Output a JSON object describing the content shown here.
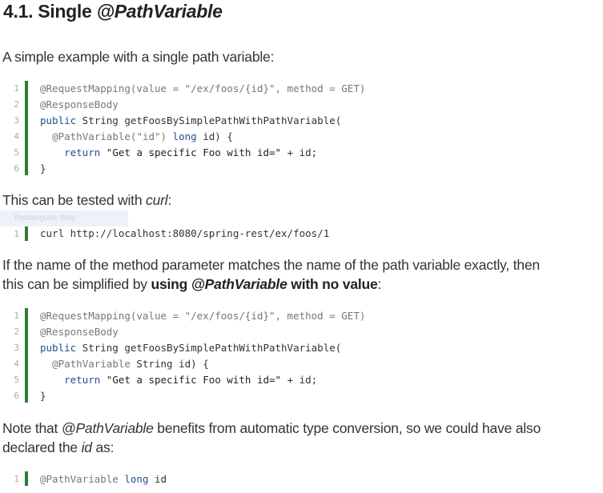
{
  "heading": {
    "prefix": "4.1. Single ",
    "annotation": "@PathVariable"
  },
  "para1": "A simple example with a single path variable:",
  "code1": {
    "lines": [
      "1",
      "2",
      "3",
      "4",
      "5",
      "6"
    ],
    "l1": "@RequestMapping(value = \"/ex/foos/{id}\", method = GET)",
    "l2": "@ResponseBody",
    "l3_kw": "public",
    "l3_rest": " String getFoosBySimplePathWithPathVariable(",
    "l4_ann": "@PathVariable(\"id\")",
    "l4_kw": "long",
    "l4_rest": " id) {",
    "l5_kw": "return",
    "l5_str": "\"Get a specific Foo with id=\"",
    "l5_rest": " + id;",
    "l6": "}"
  },
  "para2": {
    "text": "This can be tested with ",
    "em": "curl",
    "end": ":"
  },
  "tooltip": "Rectangular Snip",
  "code2": {
    "line": "1",
    "text": "curl http://localhost:8080/spring-rest/ex/foos/1"
  },
  "para3": {
    "text1": "If the name of the method parameter matches the name of the path variable exactly, then",
    "text2": "this can be simplified by ",
    "bold1": "using ",
    "bold_em": "@PathVariable",
    "bold2": " with no value",
    "end": ":"
  },
  "code3": {
    "lines": [
      "1",
      "2",
      "3",
      "4",
      "5",
      "6"
    ],
    "l1": "@RequestMapping(value = \"/ex/foos/{id}\", method = GET)",
    "l2": "@ResponseBody",
    "l3_kw": "public",
    "l3_rest": " String getFoosBySimplePathWithPathVariable(",
    "l4_ann": "@PathVariable",
    "l4_rest": " String id) {",
    "l5_kw": "return",
    "l5_str": "\"Get a specific Foo with id=\"",
    "l5_rest": " + id;",
    "l6": "}"
  },
  "para4": {
    "t1": "Note that ",
    "em1": "@PathVariable",
    "t2": " benefits from automatic type conversion, so we could have also",
    "t3": "declared the ",
    "em2": "id",
    "t4": " as:"
  },
  "code4": {
    "line": "1",
    "ann": "@PathVariable",
    "kw": "long",
    "rest": " id"
  }
}
